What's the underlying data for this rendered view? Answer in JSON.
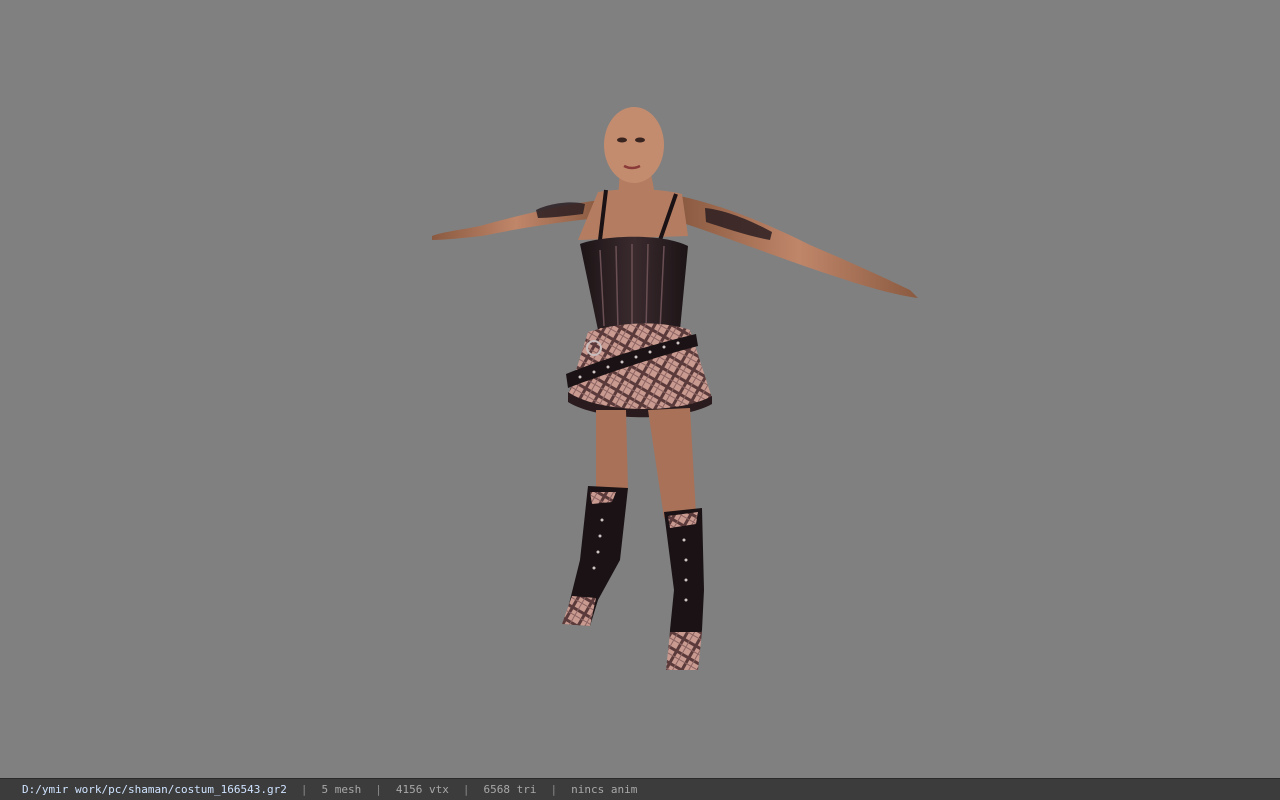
{
  "status": {
    "file_path": "D:/ymir work/pc/shaman/costum_166543.gr2",
    "mesh": "5 mesh",
    "vtx": "4156 vtx",
    "tri": "6568 tri",
    "anim": "nincs anim",
    "separator": "|"
  },
  "viewport": {
    "background_color": "#808080",
    "model": "character-model"
  },
  "colors": {
    "statusbar_bg": "#3c3c3c",
    "path_text": "#cfe3ff",
    "stat_text": "#a8a8a8"
  }
}
